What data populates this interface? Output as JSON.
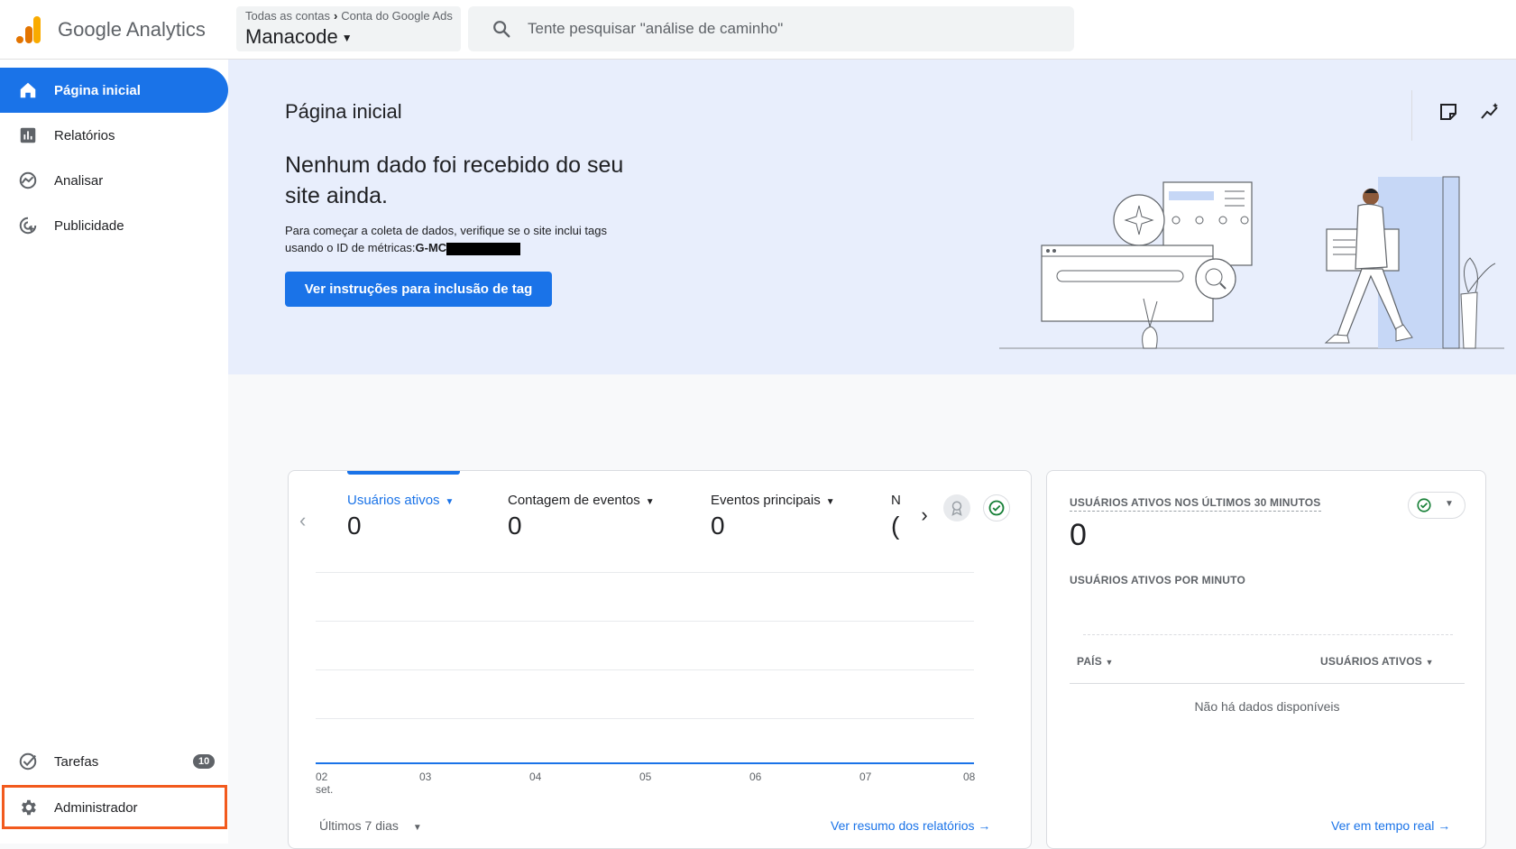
{
  "app": {
    "title": "Google Analytics"
  },
  "account": {
    "breadcrumb_all": "Todas as contas",
    "breadcrumb_account": "Conta do Google Ads",
    "property": "Manacode"
  },
  "search": {
    "placeholder": "Tente pesquisar \"análise de caminho\""
  },
  "sidebar": {
    "items": [
      {
        "label": "Página inicial",
        "icon": "home-icon"
      },
      {
        "label": "Relatórios",
        "icon": "bar-chart-icon"
      },
      {
        "label": "Analisar",
        "icon": "explore-icon"
      },
      {
        "label": "Publicidade",
        "icon": "ads-icon"
      }
    ],
    "tasks": {
      "label": "Tarefas",
      "count": "10",
      "icon": "check-circle-icon"
    },
    "admin": {
      "label": "Administrador",
      "icon": "gear-icon"
    }
  },
  "hero": {
    "title": "Página inicial",
    "headline": "Nenhum dado foi recebido do seu site ainda.",
    "body_prefix": "Para começar a coleta de dados, verifique se o site inclui tags usando o ID de métricas:",
    "measurement_id": "G-MC",
    "button": "Ver instruções para inclusão de tag",
    "icons": [
      "notes-icon",
      "insights-icon"
    ]
  },
  "overview": {
    "metrics": [
      {
        "label": "Usuários ativos",
        "value": "0"
      },
      {
        "label": "Contagem de eventos",
        "value": "0"
      },
      {
        "label": "Eventos principais",
        "value": "0"
      },
      {
        "label": "N",
        "value": "("
      }
    ],
    "x_ticks": [
      "02",
      "03",
      "04",
      "05",
      "06",
      "07",
      "08"
    ],
    "x_tick_sub": "set.",
    "date_range": "Últimos 7 dias",
    "link": "Ver resumo dos relatórios"
  },
  "realtime": {
    "title": "USUÁRIOS ATIVOS NOS ÚLTIMOS 30 MINUTOS",
    "value": "0",
    "subtitle": "USUÁRIOS ATIVOS POR MINUTO",
    "col_country": "PAÍS",
    "col_users": "USUÁRIOS ATIVOS",
    "empty": "Não há dados disponíveis",
    "link": "Ver em tempo real"
  },
  "colors": {
    "primary": "#1a73e8",
    "highlight": "#f25a1d",
    "success": "#188038",
    "hero_bg": "#e8eefc"
  }
}
